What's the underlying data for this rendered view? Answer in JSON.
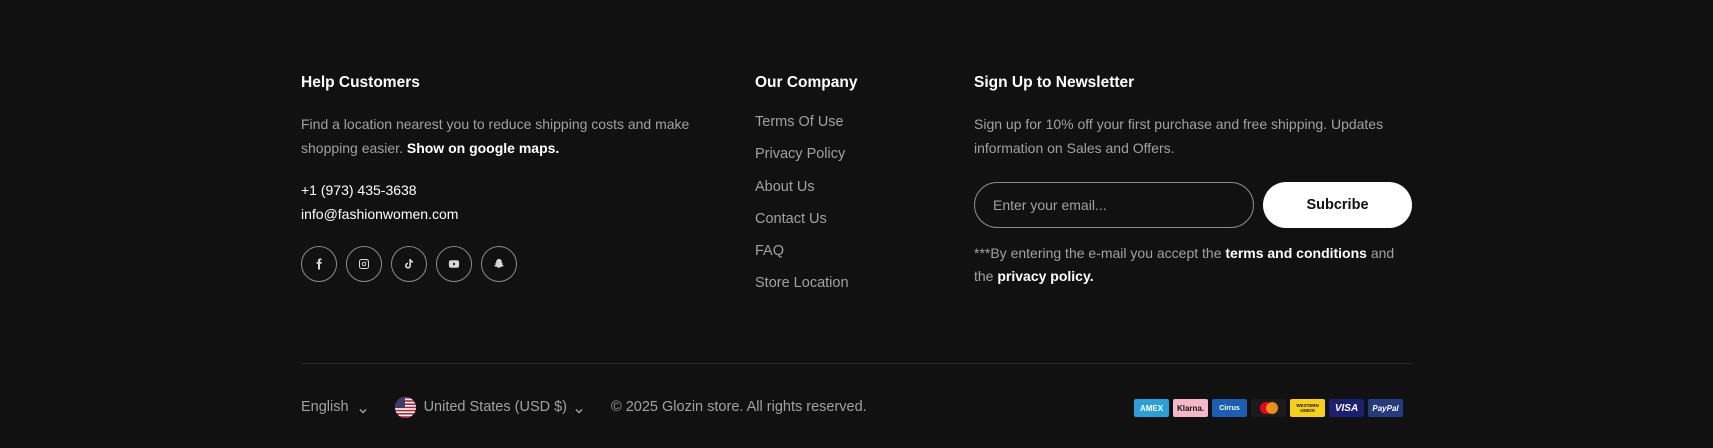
{
  "help": {
    "title": "Help Customers",
    "description": "Find a location nearest you to reduce shipping costs and make shopping easier.",
    "map_link": "Show on google maps.",
    "phone": "+1 (973) 435-3638",
    "email": "info@fashionwomen.com",
    "socials": [
      "facebook-icon",
      "instagram-icon",
      "tiktok-icon",
      "youtube-icon",
      "snapchat-icon"
    ]
  },
  "company": {
    "title": "Our Company",
    "links": [
      "Terms Of Use",
      "Privacy Policy",
      "About Us",
      "Contact Us",
      "FAQ",
      "Store Location"
    ]
  },
  "newsletter": {
    "title": "Sign Up to Newsletter",
    "description": "Sign up for 10% off your first purchase and free shipping. Updates information on Sales and Offers.",
    "placeholder": "Enter your email...",
    "button": "Subcribe",
    "note_prefix": "***By entering the e-mail you accept the",
    "terms_link": "terms and conditions",
    "note_mid": "and the",
    "privacy_link": "privacy policy."
  },
  "bottom": {
    "language": "English",
    "currency": "United States (USD $)",
    "copyright": "© 2025 Glozin store. All rights reserved.",
    "payments": [
      {
        "label": "AMEX",
        "bg": "#2a9fd8",
        "fg": "#ffffff"
      },
      {
        "label": "Klarna.",
        "bg": "#f6b8c8",
        "fg": "#111111"
      },
      {
        "label": "Cirrus",
        "bg": "#1a5fb4",
        "fg": "#ffffff"
      },
      {
        "label": "",
        "bg": "#1b1b1b",
        "fg": "#ffffff"
      },
      {
        "label": "WESTERN UNION",
        "bg": "#f7d117",
        "fg": "#111111"
      },
      {
        "label": "VISA",
        "bg": "#1a1f71",
        "fg": "#ffffff"
      },
      {
        "label": "PayPal",
        "bg": "#253b80",
        "fg": "#ffffff"
      }
    ]
  }
}
